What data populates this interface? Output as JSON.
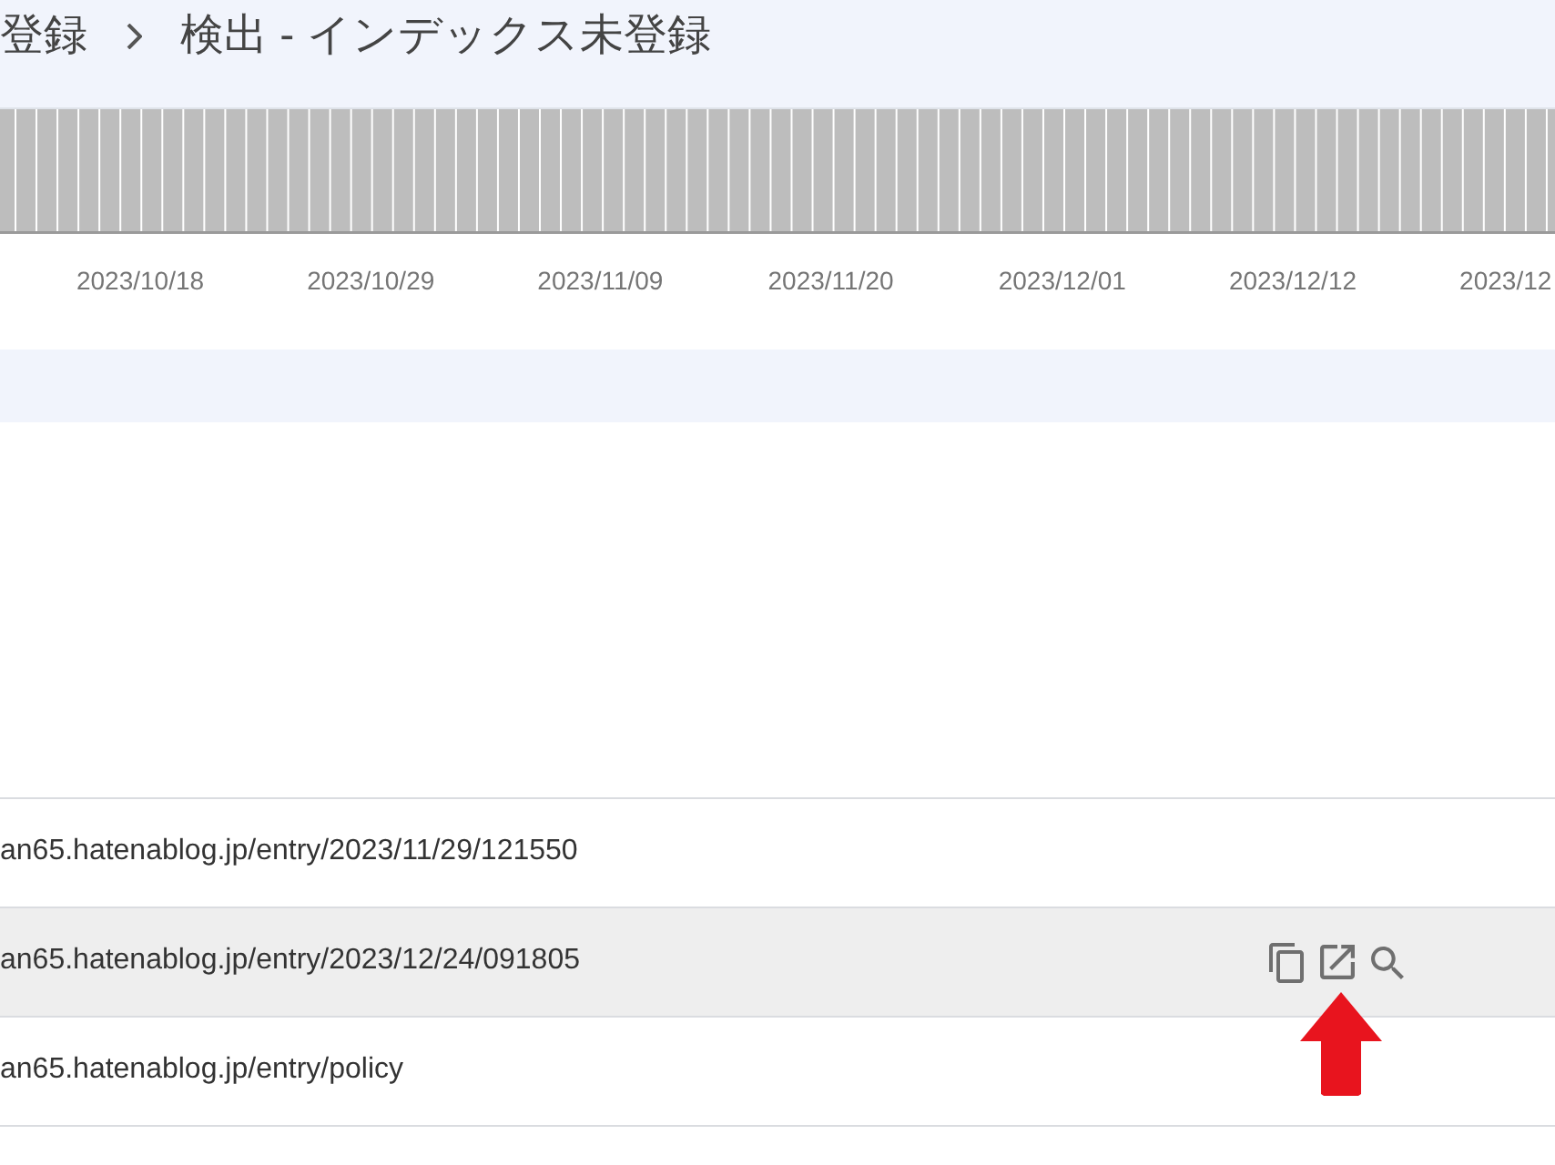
{
  "breadcrumb": {
    "items": [
      {
        "label": "登録"
      },
      {
        "label": "検出 - インデックス未登録"
      }
    ]
  },
  "chart": {
    "x_labels": [
      "2023/10/18",
      "2023/10/29",
      "2023/11/09",
      "2023/11/20",
      "2023/12/01",
      "2023/12/12",
      "2023/12"
    ]
  },
  "table": {
    "rows": [
      {
        "url": "an65.hatenablog.jp/entry/2023/11/29/121550",
        "hovered": false
      },
      {
        "url": "an65.hatenablog.jp/entry/2023/12/24/091805",
        "hovered": true
      },
      {
        "url": "an65.hatenablog.jp/entry/policy",
        "hovered": false
      }
    ]
  },
  "annotations": [
    {
      "kind": "arrow"
    }
  ]
}
